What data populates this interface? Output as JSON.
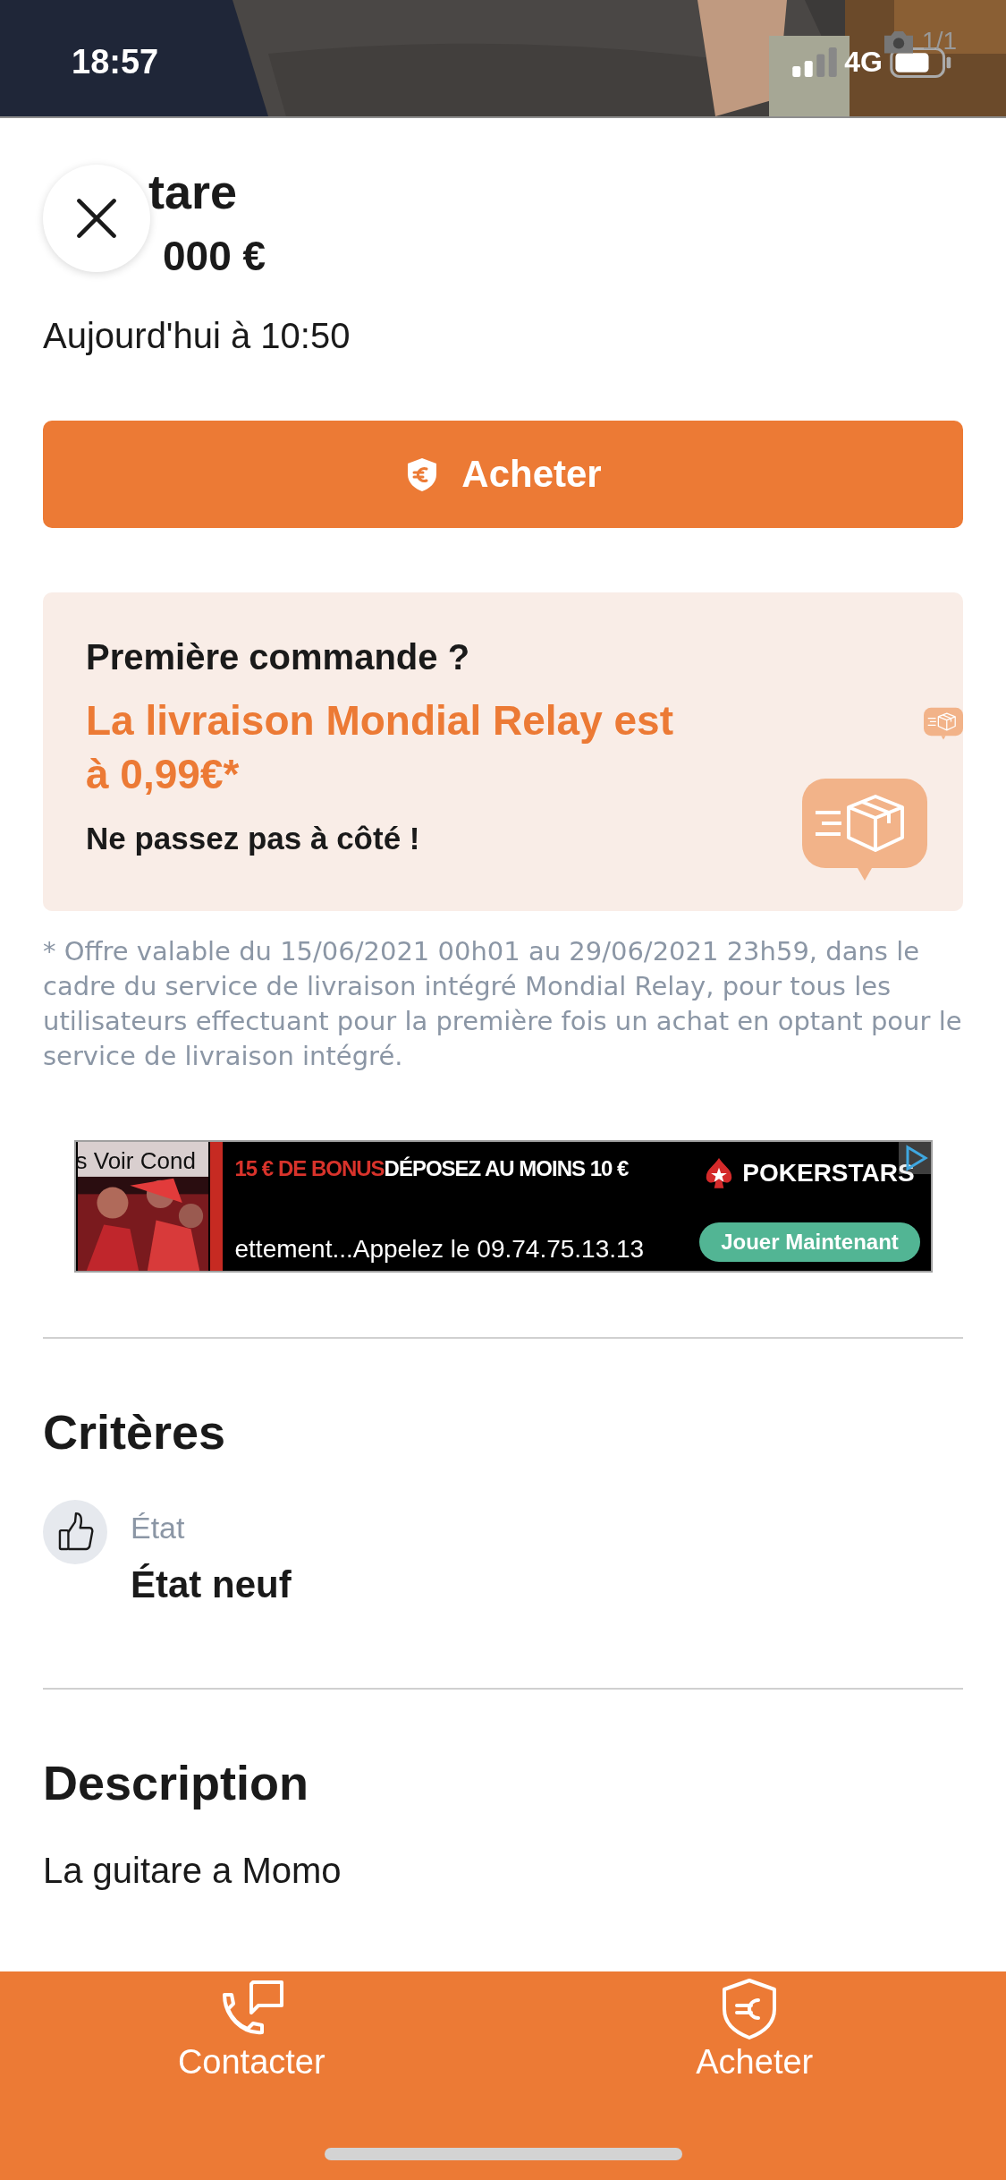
{
  "status_bar": {
    "time": "18:57",
    "network": "4G"
  },
  "photo": {
    "kind": "picture",
    "counter": "1/1"
  },
  "listing": {
    "title": "tare",
    "price": "000 €",
    "date": "Aujourd'hui à 10:50"
  },
  "buy_button": {
    "label": "Acheter"
  },
  "promo": {
    "heading": "Première commande ?",
    "offer": "La livraison Mondial Relay est à 0,99€*",
    "cta": "Ne passez pas à côté !"
  },
  "disclaimer": "* Offre valable du 15/06/2021 00h01 au 29/06/2021 23h59, dans le cadre du service de livraison intégré Mondial Relay, pour tous les utilisateurs effectuant pour la première fois un achat en optant pour le service de livraison intégré.",
  "ad": {
    "overlay": "s Voir Cond",
    "bonus": "15 € DE BONUS",
    "headline": "DÉPOSEZ AU MOINS 10 €",
    "ticker": "ettement...Appelez le 09.74.75.13.13",
    "brand": "POKERSTARS",
    "button": "Jouer Maintenant"
  },
  "criteria": {
    "title": "Critères",
    "items": [
      {
        "label": "État",
        "value": "État neuf"
      }
    ]
  },
  "description": {
    "title": "Description",
    "text": "La guitare a Momo"
  },
  "bottom_bar": {
    "actions": [
      {
        "kind": "contact",
        "label": "Contacter"
      },
      {
        "kind": "buy",
        "label": "Acheter"
      }
    ]
  }
}
